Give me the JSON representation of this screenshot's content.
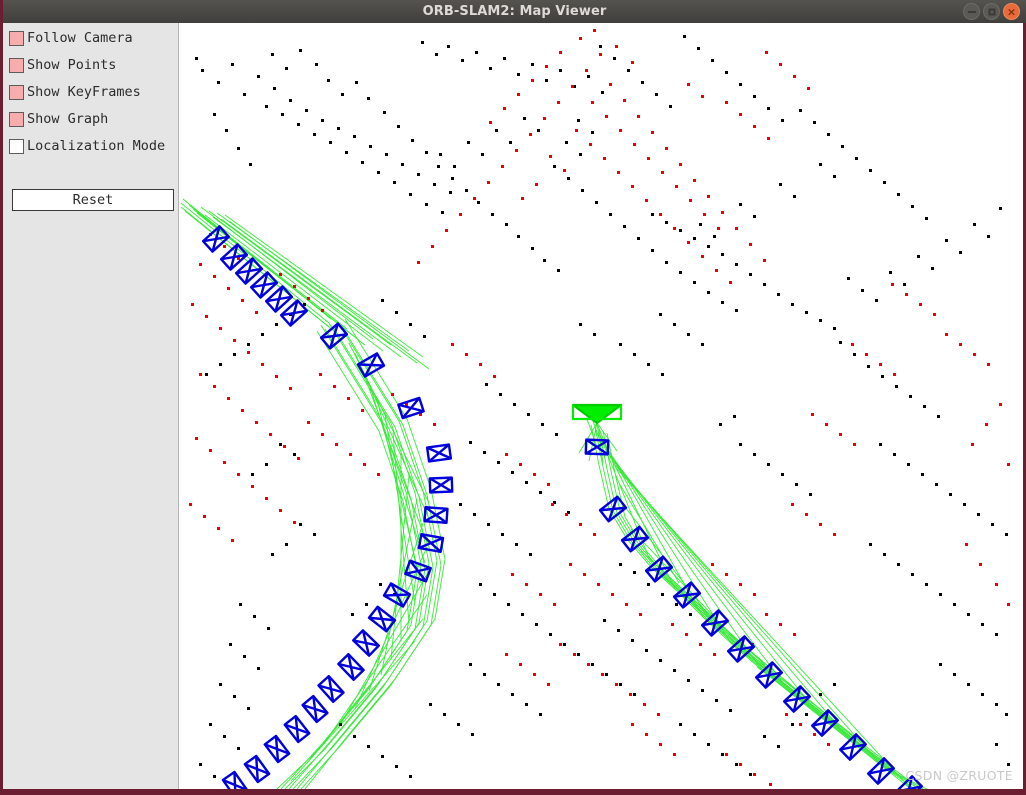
{
  "window": {
    "title": "ORB-SLAM2: Map Viewer",
    "controls": {
      "minimize_label": "−",
      "maximize_label": "□",
      "close_label": "×"
    },
    "border_color": "#6b1e31",
    "titlebar_color": "#4a4845"
  },
  "panel": {
    "background_color": "#e5e5e5",
    "checkbox_checked_color": "#f7adad",
    "checkboxes": [
      {
        "label": "Follow Camera",
        "checked": true
      },
      {
        "label": "Show Points",
        "checked": true
      },
      {
        "label": "Show KeyFrames",
        "checked": true
      },
      {
        "label": "Show Graph",
        "checked": true
      },
      {
        "label": "Localization Mode",
        "checked": false
      }
    ],
    "reset_button": {
      "label": "Reset"
    }
  },
  "viewport": {
    "background_color": "#ffffff",
    "legend": {
      "map_point_color": "#000000",
      "local_map_point_color": "#ff0000",
      "keyframe_color": "#0000dd",
      "covisibility_graph_color": "#2fe82f",
      "current_camera_color": "#00ee00"
    },
    "camera_view": "top-down",
    "counts": {
      "keyframes_visible": 44,
      "map_points_black": 1180,
      "map_points_red": 560
    }
  },
  "watermark": {
    "text": "CSDN @ZRUOTE"
  }
}
